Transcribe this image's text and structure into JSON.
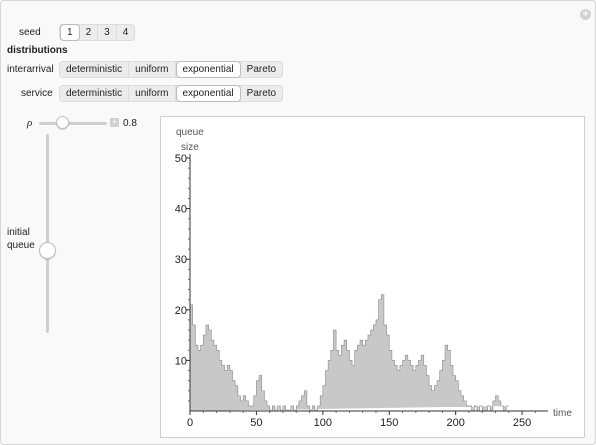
{
  "seed": {
    "label": "seed",
    "options": [
      "1",
      "2",
      "3",
      "4"
    ],
    "selected": 0
  },
  "distributions": {
    "heading": "distributions",
    "interarrival": {
      "label": "interarrival",
      "options": [
        "deterministic",
        "uniform",
        "exponential",
        "Pareto"
      ],
      "selected": 2
    },
    "service": {
      "label": "service",
      "options": [
        "deterministic",
        "uniform",
        "exponential",
        "Pareto"
      ],
      "selected": 2
    }
  },
  "rho": {
    "label": "ρ",
    "value": "0.8",
    "level": 0.3
  },
  "initial_queue": {
    "label_line1": "initial",
    "label_line2": "queue",
    "level": 0.46
  },
  "plot": {
    "chart_data": {
      "type": "area",
      "ylabel_line1": "queue",
      "ylabel_line2": "size",
      "xlabel": "time",
      "xlim": [
        0,
        265
      ],
      "ylim": [
        0,
        50
      ],
      "xticks": [
        "0",
        "50",
        "100",
        "150",
        "200",
        "250"
      ],
      "yticks": [
        "10",
        "20",
        "30",
        "40",
        "50"
      ],
      "fill": "#c8c8c8",
      "x": [
        0,
        2,
        4,
        6,
        8,
        10,
        12,
        14,
        16,
        18,
        20,
        22,
        24,
        26,
        28,
        30,
        32,
        34,
        36,
        38,
        40,
        42,
        44,
        46,
        48,
        50,
        52,
        54,
        56,
        58,
        60,
        62,
        64,
        66,
        68,
        70,
        72,
        74,
        76,
        78,
        80,
        82,
        84,
        86,
        88,
        90,
        92,
        94,
        96,
        98,
        100,
        102,
        104,
        106,
        108,
        110,
        112,
        114,
        116,
        118,
        120,
        122,
        124,
        126,
        128,
        130,
        132,
        134,
        136,
        138,
        140,
        142,
        144,
        146,
        148,
        150,
        152,
        154,
        156,
        158,
        160,
        162,
        164,
        166,
        168,
        170,
        172,
        174,
        176,
        178,
        180,
        182,
        184,
        186,
        188,
        190,
        192,
        194,
        196,
        198,
        200,
        202,
        204,
        206,
        208,
        210,
        212,
        214,
        216,
        218,
        220,
        222,
        224,
        226,
        228,
        230,
        232,
        234,
        236,
        238,
        240,
        242,
        244,
        246,
        248,
        250,
        252,
        254,
        256,
        258
      ],
      "y": [
        21,
        17,
        13,
        12,
        13,
        15,
        17,
        16,
        14,
        13,
        12,
        10,
        9,
        8,
        9,
        8,
        6,
        5,
        3,
        2,
        3,
        2,
        1,
        1,
        3,
        6,
        7,
        4,
        2,
        1,
        0,
        1,
        0,
        1,
        0,
        1,
        0,
        0,
        1,
        0,
        1,
        2,
        3,
        4,
        1,
        0,
        1,
        0,
        1,
        3,
        5,
        8,
        10,
        12,
        16,
        12,
        11,
        13,
        14,
        12,
        10,
        9,
        12,
        13,
        14,
        13,
        14,
        15,
        16,
        17,
        18,
        22,
        23,
        17,
        15,
        12,
        10,
        9,
        8,
        9,
        10,
        11,
        10,
        9,
        8,
        9,
        10,
        11,
        9,
        7,
        5,
        4,
        5,
        6,
        8,
        10,
        13,
        12,
        9,
        7,
        6,
        4,
        3,
        2,
        1,
        1,
        0,
        1,
        0,
        1,
        0,
        0,
        1,
        0,
        2,
        3,
        2,
        1,
        0,
        1
      ]
    }
  }
}
